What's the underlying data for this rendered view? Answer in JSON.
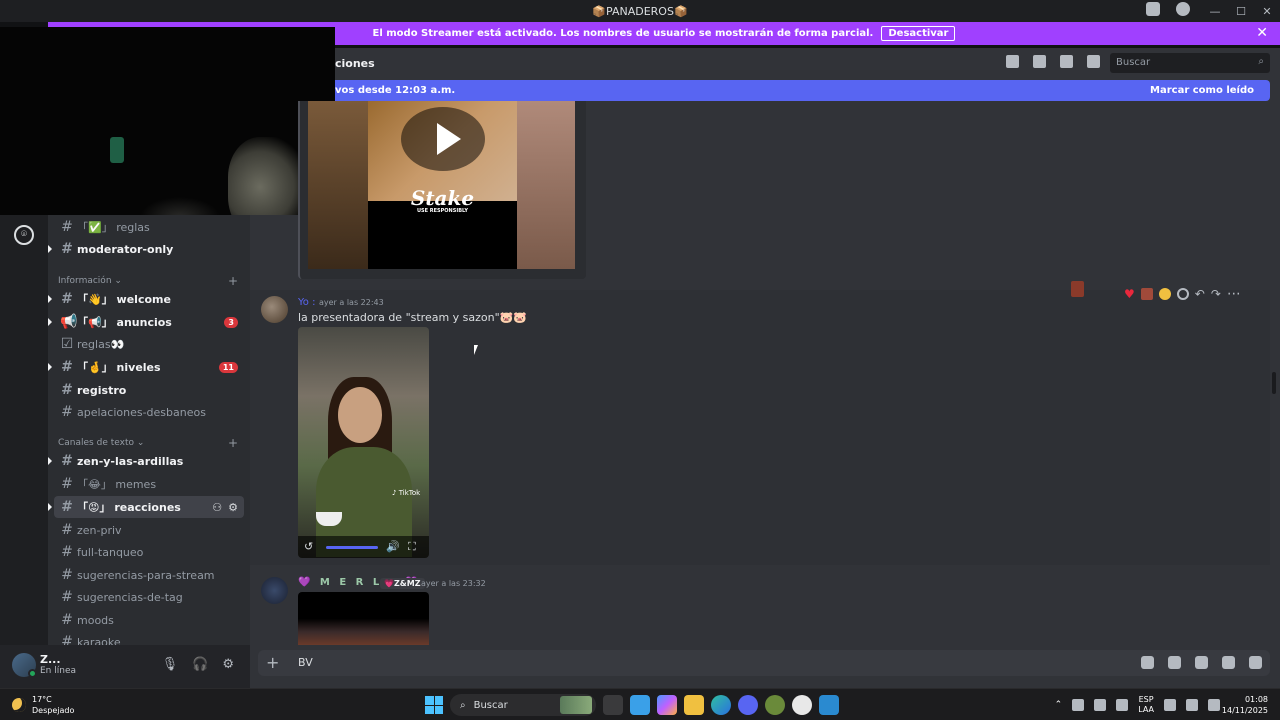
{
  "window": {
    "title": "📦PANADEROS📦",
    "controls": [
      "—",
      "☐",
      "✕"
    ]
  },
  "streamer_banner": {
    "text": "El modo Streamer está activado. Los nombres de usuario se mostrarán de forma parcial.",
    "button": "Desactivar",
    "close": "✕"
  },
  "header": {
    "channel_title": "ciones",
    "search_placeholder": "Buscar"
  },
  "new_messages_bar": {
    "text": "vos desde 12:03 a.m.",
    "mark_read": "Marcar como leído"
  },
  "sidebar": {
    "channels_top": [
      {
        "prefix": "「✅」",
        "name": "reglas",
        "bold": false
      },
      {
        "prefix": "",
        "name": "moderator-only",
        "bold": true
      }
    ],
    "category_info": "Información",
    "info_channels": [
      {
        "prefix": "「👋」",
        "name": "welcome",
        "bold": true,
        "badge": ""
      },
      {
        "prefix": "「📢」",
        "name": "anuncios",
        "bold": true,
        "badge": "3"
      },
      {
        "prefix": "",
        "name": "reglas👀",
        "bold": false,
        "badge": ""
      },
      {
        "prefix": "「🤞」",
        "name": "niveles",
        "bold": true,
        "badge": "11"
      },
      {
        "prefix": "",
        "name": "registro",
        "bold": true,
        "badge": ""
      },
      {
        "prefix": "",
        "name": "apelaciones-desbaneos",
        "bold": false,
        "badge": ""
      }
    ],
    "category_text": "Canales de texto",
    "text_channels": [
      {
        "prefix": "",
        "name": "zen-y-las-ardillas",
        "bold": true
      },
      {
        "prefix": "「😂」",
        "name": "memes",
        "bold": false
      },
      {
        "prefix": "「😡」",
        "name": "reacciones",
        "bold": true
      },
      {
        "prefix": "",
        "name": "zen-priv",
        "bold": false
      },
      {
        "prefix": "",
        "name": "full-tanqueo",
        "bold": false
      },
      {
        "prefix": "",
        "name": "sugerencias-para-stream",
        "bold": false
      },
      {
        "prefix": "",
        "name": "sugerencias-de-tag",
        "bold": false
      },
      {
        "prefix": "",
        "name": "moods",
        "bold": false
      },
      {
        "prefix": "",
        "name": "karaoke",
        "bold": false
      }
    ]
  },
  "user_panel": {
    "name": "Z...",
    "status": "En línea"
  },
  "messages": [
    {
      "author": "Yo :",
      "time": "ayer a las 22:43",
      "text": "la presentadora de \"stream y sazon\"🐷🐷",
      "embed_brand": "Stake",
      "embed_brand_sub": "USE RESPONSIBLY",
      "tiktok_label": "♪ TikTok"
    },
    {
      "author": "💜 M E R L E 💜",
      "tag": "💗Z&MZ",
      "time": "ayer a las 23:32"
    }
  ],
  "composer": {
    "value": "BV"
  },
  "taskbar": {
    "weather_temp": "17°C",
    "weather_desc": "Despejado",
    "search": "Buscar",
    "lang_top": "ESP",
    "lang_bottom": "LAA",
    "time": "01:08",
    "date": "14/11/2025"
  },
  "colors": {
    "streamer_purple": "#a040ff",
    "blurple": "#5865f2",
    "danger": "#da373c",
    "online": "#23a55a"
  }
}
